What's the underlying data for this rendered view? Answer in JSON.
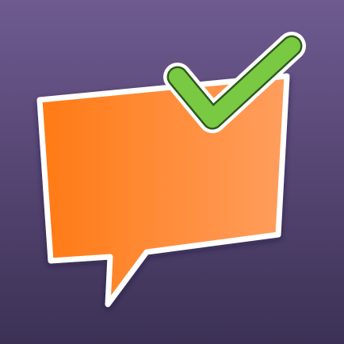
{
  "icon": {
    "name": "speech-bubble-checkmark-app-icon",
    "colors": {
      "background_top": "#6e5a90",
      "background_bottom": "#3c3155",
      "bubble_left": "#ff7a14",
      "bubble_right": "#ff9e5e",
      "outline": "#ffffff",
      "check": "#7ac943",
      "check_outline": "#2f5a1e"
    }
  }
}
